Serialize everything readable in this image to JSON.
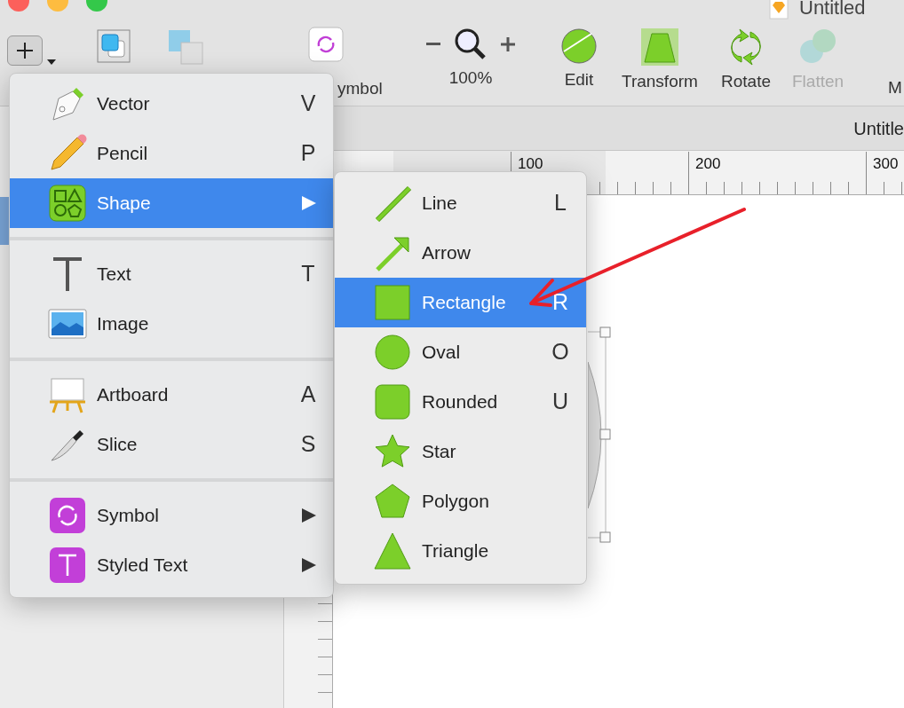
{
  "window": {
    "title": "Untitled"
  },
  "toolbar": [
    {
      "kind": "insert"
    },
    {
      "kind": "group"
    },
    {
      "kind": "ungroup"
    },
    {
      "kind": "symbol",
      "label": "ymbol"
    },
    {
      "kind": "zoom",
      "label": "100%"
    },
    {
      "kind": "edit",
      "label": "Edit",
      "disabled": false
    },
    {
      "kind": "transform",
      "label": "Transform",
      "disabled": false
    },
    {
      "kind": "rotate",
      "label": "Rotate",
      "disabled": false
    },
    {
      "kind": "flatten",
      "label": "Flatten",
      "disabled": true
    },
    {
      "kind": "more",
      "label": "M"
    }
  ],
  "document_tab": {
    "title": "Untitle"
  },
  "ruler": {
    "labels": [
      "100",
      "200",
      "300"
    ]
  },
  "insert_menu": {
    "sections": [
      [
        {
          "kind": "pen",
          "label": "Vector",
          "shortcut": "V",
          "submenu": false,
          "selected": false
        },
        {
          "kind": "pencil",
          "label": "Pencil",
          "shortcut": "P",
          "submenu": false,
          "selected": false
        },
        {
          "kind": "shapes",
          "label": "Shape",
          "submenu": true,
          "selected": true
        }
      ],
      [
        {
          "kind": "text",
          "label": "Text",
          "shortcut": "T",
          "submenu": false,
          "selected": false
        },
        {
          "kind": "image",
          "label": "Image",
          "submenu": false,
          "selected": false
        }
      ],
      [
        {
          "kind": "artboard",
          "label": "Artboard",
          "shortcut": "A",
          "submenu": false,
          "selected": false
        },
        {
          "kind": "knife",
          "label": "Slice",
          "shortcut": "S",
          "submenu": false,
          "selected": false
        }
      ],
      [
        {
          "kind": "symbol",
          "label": "Symbol",
          "submenu": true,
          "selected": false
        },
        {
          "kind": "styled",
          "label": "Styled Text",
          "submenu": true,
          "selected": false
        }
      ]
    ]
  },
  "shape_menu": {
    "items": [
      {
        "kind": "line",
        "label": "Line",
        "shortcut": "L",
        "selected": false
      },
      {
        "kind": "arrow",
        "label": "Arrow",
        "selected": false
      },
      {
        "kind": "rect",
        "label": "Rectangle",
        "shortcut": "R",
        "selected": true
      },
      {
        "kind": "oval",
        "label": "Oval",
        "shortcut": "O",
        "selected": false
      },
      {
        "kind": "rounded",
        "label": "Rounded",
        "shortcut": "U",
        "selected": false
      },
      {
        "kind": "star",
        "label": "Star",
        "selected": false
      },
      {
        "kind": "polygon",
        "label": "Polygon",
        "selected": false
      },
      {
        "kind": "triangle",
        "label": "Triangle",
        "selected": false
      }
    ]
  }
}
